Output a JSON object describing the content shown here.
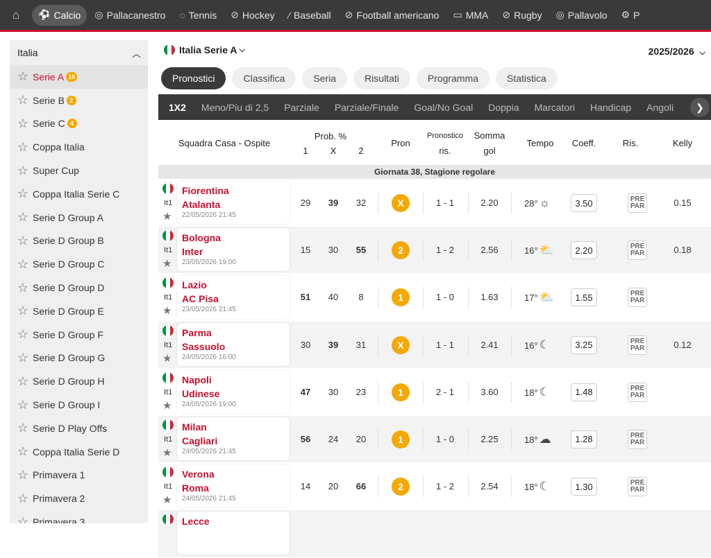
{
  "topnav": {
    "home_icon": "home-icon",
    "sports": [
      {
        "label": "Calcio",
        "icon": "⚽",
        "active": true
      },
      {
        "label": "Pallacanestro",
        "icon": "◎"
      },
      {
        "label": "Tennis",
        "icon": "◌"
      },
      {
        "label": "Hockey",
        "icon": "⊘"
      },
      {
        "label": "Baseball",
        "icon": "⁄"
      },
      {
        "label": "Football americano",
        "icon": "⊘"
      },
      {
        "label": "MMA",
        "icon": "▭"
      },
      {
        "label": "Rugby",
        "icon": "⊘"
      },
      {
        "label": "Pallavolo",
        "icon": "◎"
      },
      {
        "label": "P",
        "icon": "⚙"
      }
    ]
  },
  "sidebar": {
    "title": "Italia",
    "items": [
      {
        "label": "Serie A",
        "badge": "10",
        "active": true
      },
      {
        "label": "Serie B",
        "badge": "2"
      },
      {
        "label": "Serie C",
        "badge": "4"
      },
      {
        "label": "Coppa Italia"
      },
      {
        "label": "Super Cup"
      },
      {
        "label": "Coppa Italia Serie C"
      },
      {
        "label": "Serie D Group A"
      },
      {
        "label": "Serie D Group B"
      },
      {
        "label": "Serie D Group C"
      },
      {
        "label": "Serie D Group D"
      },
      {
        "label": "Serie D Group E"
      },
      {
        "label": "Serie D Group F"
      },
      {
        "label": "Serie D Group G"
      },
      {
        "label": "Serie D Group H"
      },
      {
        "label": "Serie D Group I"
      },
      {
        "label": "Serie D Play Offs"
      },
      {
        "label": "Coppa Italia Serie D"
      },
      {
        "label": "Primavera 1"
      },
      {
        "label": "Primavera 2"
      },
      {
        "label": "Primavera 3"
      }
    ]
  },
  "league": {
    "name": "Italia Serie A",
    "season": "2025/2026"
  },
  "pills": [
    "Pronostici",
    "Classifica",
    "Seria",
    "Risultati",
    "Programma",
    "Statistica"
  ],
  "subtabs": [
    "1X2",
    "Meno/Piu di 2,5",
    "Parziale",
    "Parziale/Finale",
    "Goal/No Goal",
    "Doppia",
    "Marcatori",
    "Handicap",
    "Angoli"
  ],
  "columns": {
    "match": "Squadra Casa - Ospite",
    "prob": "Prob. %",
    "p1": "1",
    "px": "X",
    "p2": "2",
    "pron": "Pron",
    "pron_ris_a": "Pronostico",
    "pron_ris_b": "ris.",
    "somma_a": "Somma",
    "somma_b": "gol",
    "tempo": "Tempo",
    "coeff": "Coeff.",
    "ris": "Ris.",
    "kelly": "Kelly"
  },
  "group_title": "Giornata 38, Stagione regolare",
  "matches": [
    {
      "home": "Fiorentina",
      "away": "Atalanta",
      "date": "22/05/2026 21:45",
      "comp": "It1",
      "p1": "29",
      "px": "39",
      "p2": "32",
      "bold": "x",
      "pron": "X",
      "score": "1 - 1",
      "goals": "2.20",
      "temp": "28°",
      "wicon": "☼",
      "coef": "3.50",
      "kelly": "0.15"
    },
    {
      "home": "Bologna",
      "away": "Inter",
      "date": "23/05/2026 19:00",
      "comp": "It1",
      "p1": "15",
      "px": "30",
      "p2": "55",
      "bold": "2",
      "pron": "2",
      "score": "1 - 2",
      "goals": "2.56",
      "temp": "16°",
      "wicon": "⛅",
      "coef": "2.20",
      "kelly": "0.18"
    },
    {
      "home": "Lazio",
      "away": "AC Pisa",
      "date": "23/05/2026 21:45",
      "comp": "It1",
      "p1": "51",
      "px": "40",
      "p2": "8",
      "bold": "1",
      "pron": "1",
      "score": "1 - 0",
      "goals": "1.63",
      "temp": "17°",
      "wicon": "⛅",
      "coef": "1.55",
      "kelly": ""
    },
    {
      "home": "Parma",
      "away": "Sassuolo",
      "date": "24/05/2026 16:00",
      "comp": "It1",
      "p1": "30",
      "px": "39",
      "p2": "31",
      "bold": "x",
      "pron": "X",
      "score": "1 - 1",
      "goals": "2.41",
      "temp": "16°",
      "wicon": "☾",
      "coef": "3.25",
      "kelly": "0.12"
    },
    {
      "home": "Napoli",
      "away": "Udinese",
      "date": "24/05/2026 19:00",
      "comp": "It1",
      "p1": "47",
      "px": "30",
      "p2": "23",
      "bold": "1",
      "pron": "1",
      "score": "2 - 1",
      "goals": "3.60",
      "temp": "18°",
      "wicon": "☾",
      "coef": "1.48",
      "kelly": ""
    },
    {
      "home": "Milan",
      "away": "Cagliari",
      "date": "24/05/2026 21:45",
      "comp": "It1",
      "p1": "56",
      "px": "24",
      "p2": "20",
      "bold": "1",
      "pron": "1",
      "score": "1 - 0",
      "goals": "2.25",
      "temp": "18°",
      "wicon": "☁",
      "coef": "1.28",
      "kelly": ""
    },
    {
      "home": "Verona",
      "away": "Roma",
      "date": "24/05/2026 21:45",
      "comp": "It1",
      "p1": "14",
      "px": "20",
      "p2": "66",
      "bold": "2",
      "pron": "2",
      "score": "1 - 2",
      "goals": "2.54",
      "temp": "18°",
      "wicon": "☾",
      "coef": "1.30",
      "kelly": ""
    },
    {
      "home": "Lecce",
      "away": "",
      "date": "",
      "comp": "",
      "p1": "",
      "px": "",
      "p2": "",
      "bold": "",
      "pron": "",
      "score": "",
      "goals": "",
      "temp": "",
      "wicon": "",
      "coef": "",
      "kelly": ""
    }
  ],
  "pre_label_a": "PRE",
  "pre_label_b": "PAR",
  "colors": {
    "accent": "#c8102e",
    "badge": "#f5a800",
    "dark": "#3a3a3a"
  }
}
